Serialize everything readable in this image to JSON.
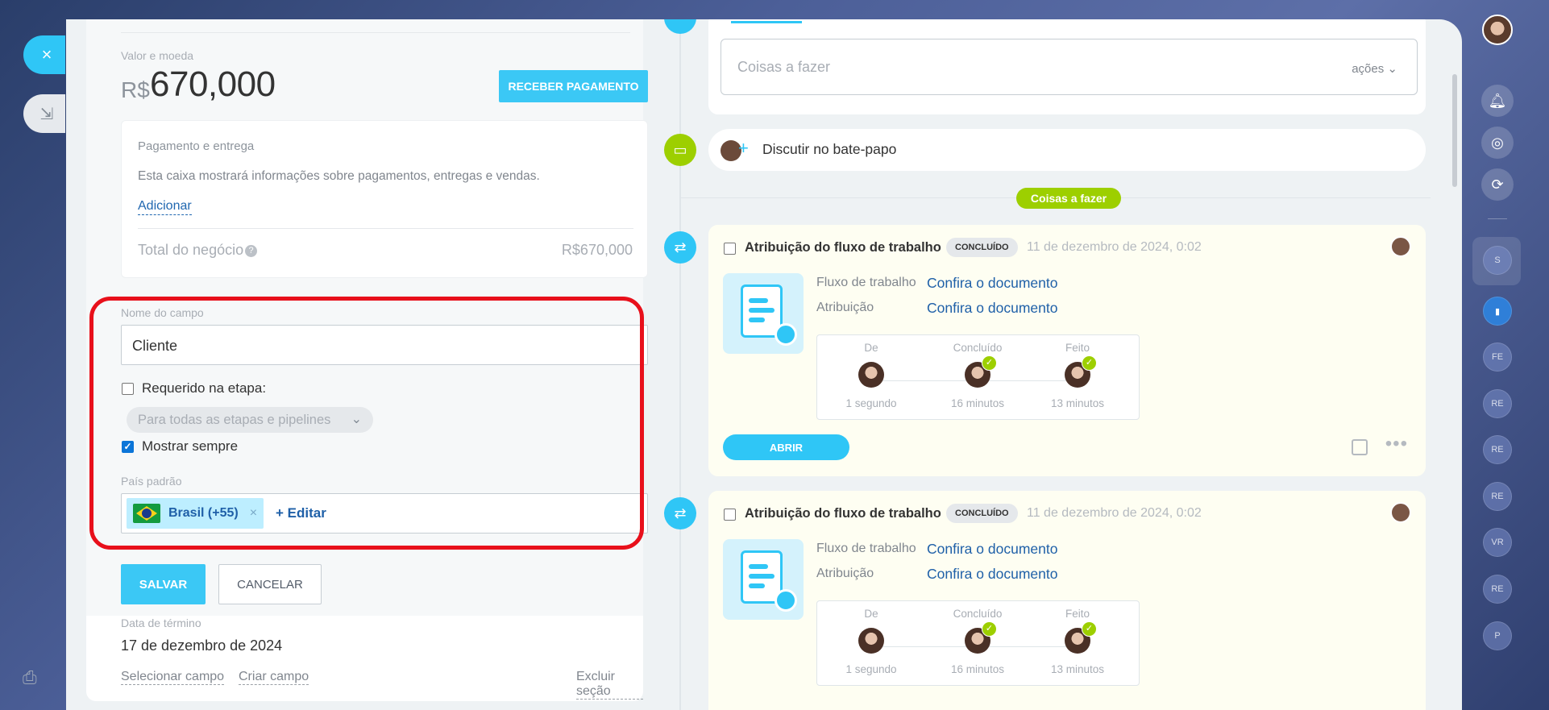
{
  "window": {
    "close_icon": "×",
    "minimize_icon": "⇲"
  },
  "left": {
    "amount_label": "Valor e moeda",
    "currency": "R$",
    "amount": "670,000",
    "receive_button": "RECEBER PAGAMENTO",
    "payment": {
      "title": "Pagamento e entrega",
      "description": "Esta caixa mostrará informações sobre pagamentos, entregas e vendas.",
      "add_link": "Adicionar",
      "total_label": "Total do negócio",
      "total_value": "R$670,000"
    },
    "field": {
      "name_label": "Nome do campo",
      "name_value": "Cliente",
      "required_label": "Requerido na etapa:",
      "required_checked": false,
      "stage_select": "Para todas as etapas e pipelines",
      "show_always_label": "Mostrar sempre",
      "show_always_checked": true,
      "country_label": "País padrão",
      "country_tag": "Brasil (+55)",
      "country_remove": "×",
      "edit_link": "+ Editar"
    },
    "save_button": "SALVAR",
    "cancel_button": "CANCELAR",
    "end_date_label": "Data de término",
    "end_date_value": "17 de dezembro de 2024",
    "footer": {
      "select_field": "Selecionar campo",
      "create_field": "Criar campo",
      "delete_section": "Excluir seção"
    }
  },
  "timeline": {
    "todo_placeholder": "Coisas a fazer",
    "todo_actions": "ações",
    "chat_text": "Discutir no bate-papo",
    "section_badge": "Coisas a fazer",
    "activities": [
      {
        "title": "Atribuição do fluxo de trabalho",
        "status": "CONCLUÍDO",
        "date": "11 de dezembro de 2024, 0:02",
        "workflow_label": "Fluxo de trabalho",
        "workflow_link": "Confira o documento",
        "assignment_label": "Atribuição",
        "assignment_link": "Confira o documento",
        "steps": [
          {
            "head": "De",
            "time": "1 segundo",
            "done": false
          },
          {
            "head": "Concluído",
            "time": "16 minutos",
            "done": true
          },
          {
            "head": "Feito",
            "time": "13 minutos",
            "done": true
          }
        ],
        "open_button": "ABRIR"
      },
      {
        "title": "Atribuição do fluxo de trabalho",
        "status": "CONCLUÍDO",
        "date": "11 de dezembro de 2024, 0:02",
        "workflow_label": "Fluxo de trabalho",
        "workflow_link": "Confira o documento",
        "assignment_label": "Atribuição",
        "assignment_link": "Confira o documento",
        "steps": [
          {
            "head": "De",
            "time": "1 segundo",
            "done": false
          },
          {
            "head": "Concluído",
            "time": "16 minutos",
            "done": true
          },
          {
            "head": "Feito",
            "time": "13 minutos",
            "done": true
          }
        ]
      }
    ]
  },
  "sidebar": {
    "bubbles": [
      "S",
      "FE",
      "FE",
      "RE",
      "RE",
      "RE",
      "VR",
      "RE",
      "P"
    ]
  },
  "colors": {
    "accent": "#2fc6f6",
    "green": "#9dcf00",
    "highlight": "#e8101b"
  }
}
